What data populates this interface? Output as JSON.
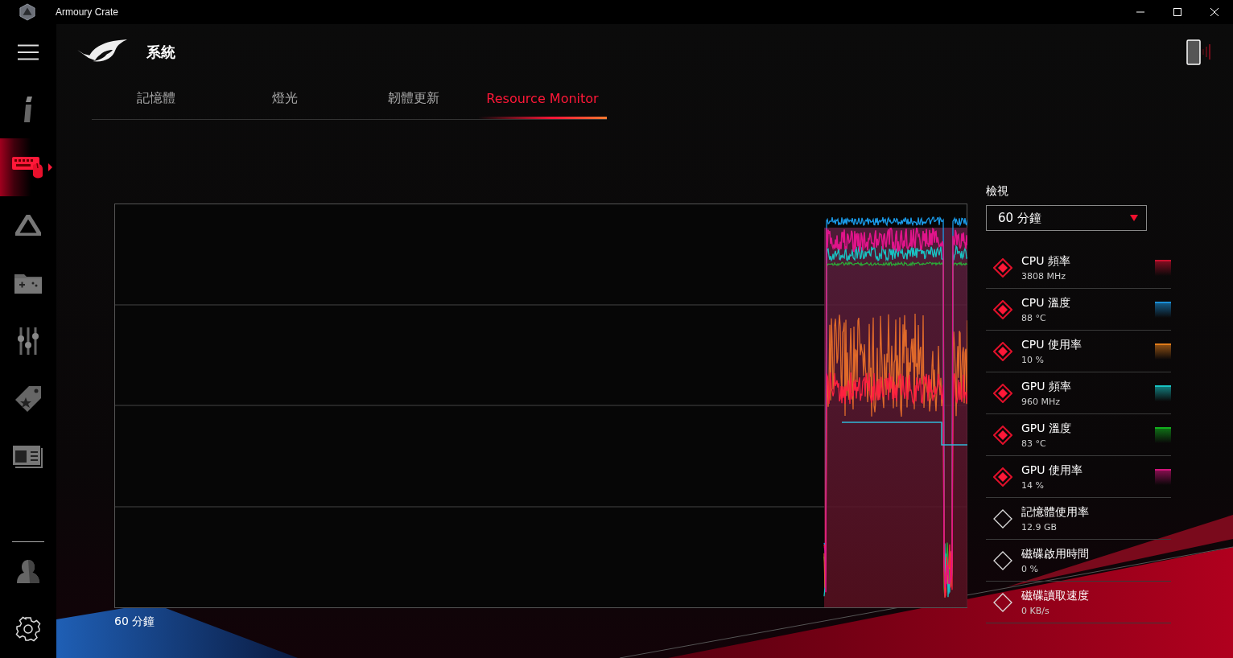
{
  "window": {
    "title": "Armoury Crate"
  },
  "sidebar": {
    "items": [
      {
        "selected": false
      },
      {
        "selected": true
      },
      {
        "selected": false
      },
      {
        "selected": false
      },
      {
        "selected": false
      },
      {
        "selected": false
      },
      {
        "selected": false
      }
    ]
  },
  "header": {
    "title": "系統"
  },
  "tabs": [
    {
      "label": "記憶體",
      "selected": false
    },
    {
      "label": "燈光",
      "selected": false
    },
    {
      "label": "韌體更新",
      "selected": false
    },
    {
      "label": "Resource Monitor",
      "selected": true
    }
  ],
  "chart": {
    "range_label": "60 分鐘"
  },
  "panel": {
    "view_label": "檢視",
    "view_select": {
      "value": "60 分鐘"
    },
    "metrics": [
      {
        "name": "CPU 頻率",
        "value": "3808 MHz",
        "checked": true,
        "color": "#c8102e"
      },
      {
        "name": "CPU 溫度",
        "value": "88 °C",
        "checked": true,
        "color": "#1a8fd8"
      },
      {
        "name": "CPU 使用率",
        "value": "10 %",
        "checked": true,
        "color": "#e07b1a"
      },
      {
        "name": "GPU 頻率",
        "value": "960 MHz",
        "checked": true,
        "color": "#18c4c4"
      },
      {
        "name": "GPU 溫度",
        "value": "83 °C",
        "checked": true,
        "color": "#12b01e"
      },
      {
        "name": "GPU 使用率",
        "value": "14 %",
        "checked": true,
        "color": "#d0147a"
      },
      {
        "name": "記憶體使用率",
        "value": "12.9 GB",
        "checked": false
      },
      {
        "name": "磁碟啟用時間",
        "value": "0 %",
        "checked": false
      },
      {
        "name": "磁碟讀取速度",
        "value": "0 KB/s",
        "checked": false
      }
    ]
  }
}
